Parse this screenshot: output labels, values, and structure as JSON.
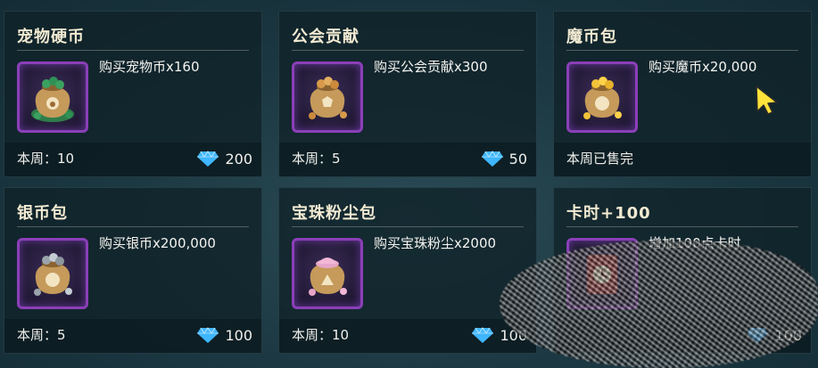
{
  "colors": {
    "accent_purple": "#8b3fb8",
    "gem_blue": "#3fb6ff",
    "title_text": "#f2ead2"
  },
  "cards": [
    {
      "title": "宠物硬币",
      "icon": "pet-coin-bag-icon",
      "desc": "购买宠物币x160",
      "weekly": "本周：10",
      "price": "200"
    },
    {
      "title": "公会贡献",
      "icon": "guild-contribution-bag-icon",
      "desc": "购买公会贡献x300",
      "weekly": "本周：5",
      "price": "50"
    },
    {
      "title": "魔币包",
      "icon": "magic-coin-bag-icon",
      "desc": "购买魔币x20,000",
      "weekly": "本周已售完",
      "price": ""
    },
    {
      "title": "银币包",
      "icon": "silver-coin-bag-icon",
      "desc": "购买银币x200,000",
      "weekly": "本周：5",
      "price": "100"
    },
    {
      "title": "宝珠粉尘包",
      "icon": "orb-dust-bag-icon",
      "desc": "购买宝珠粉尘x2000",
      "weekly": "本周：10",
      "price": "100"
    },
    {
      "title": "卡时+100",
      "icon": "card-time-icon",
      "desc": "增加100点卡时",
      "weekly": "",
      "price": "100"
    }
  ]
}
